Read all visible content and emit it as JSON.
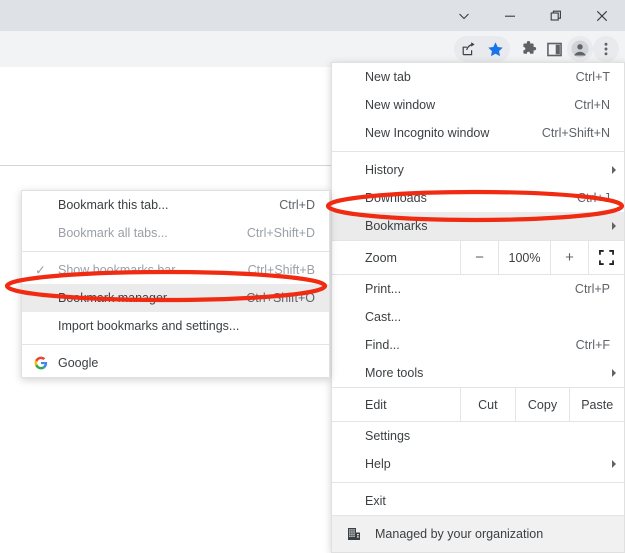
{
  "window_controls": [
    {
      "name": "tab-search-chevron",
      "icon": "chevron-down-icon"
    },
    {
      "name": "minimize",
      "icon": "minimize-icon"
    },
    {
      "name": "maximize",
      "icon": "restore-icon"
    },
    {
      "name": "close",
      "icon": "close-icon"
    }
  ],
  "toolbar": {
    "icons": [
      {
        "name": "share-icon",
        "label": "Share this tab"
      },
      {
        "name": "bookmark-star-icon",
        "label": "Bookmark this tab",
        "color": "#1a73e8"
      },
      {
        "name": "extensions-puzzle-icon",
        "label": "Extensions"
      },
      {
        "name": "side-panel-icon",
        "label": "Side panel"
      },
      {
        "name": "profile-avatar-icon",
        "label": "Profile"
      },
      {
        "name": "three-dot-menu-icon",
        "label": "Customize and control Google Chrome"
      }
    ]
  },
  "main_menu": {
    "items": [
      {
        "label": "New tab",
        "accel": "Ctrl+T",
        "submenu": false,
        "highlight": false
      },
      {
        "label": "New window",
        "accel": "Ctrl+N",
        "submenu": false,
        "highlight": false
      },
      {
        "label": "New Incognito window",
        "accel": "Ctrl+Shift+N",
        "submenu": false,
        "highlight": false
      },
      {
        "label": "History",
        "accel": "",
        "submenu": true,
        "highlight": false
      },
      {
        "label": "Downloads",
        "accel": "Ctrl+J",
        "submenu": false,
        "highlight": false
      },
      {
        "label": "Bookmarks",
        "accel": "",
        "submenu": true,
        "highlight": true
      },
      {
        "label": "Print...",
        "accel": "Ctrl+P",
        "submenu": false,
        "highlight": false
      },
      {
        "label": "Cast...",
        "accel": "",
        "submenu": false,
        "highlight": false
      },
      {
        "label": "Find...",
        "accel": "Ctrl+F",
        "submenu": false,
        "highlight": false
      },
      {
        "label": "More tools",
        "accel": "",
        "submenu": true,
        "highlight": false
      },
      {
        "label": "Settings",
        "accel": "",
        "submenu": false,
        "highlight": false
      },
      {
        "label": "Help",
        "accel": "",
        "submenu": true,
        "highlight": false
      },
      {
        "label": "Exit",
        "accel": "",
        "submenu": false,
        "highlight": false
      }
    ],
    "zoom_row": {
      "label": "Zoom",
      "minus": "−",
      "value": "100%",
      "plus": "+",
      "fullscreen_icon": "fullscreen-icon"
    },
    "edit_row": {
      "label": "Edit",
      "cut": "Cut",
      "copy": "Copy",
      "paste": "Paste"
    },
    "managed": {
      "label": "Managed by your organization",
      "icon": "organization-building-icon"
    }
  },
  "bookmarks_submenu": {
    "items": [
      {
        "label": "Bookmark this tab...",
        "accel": "Ctrl+D",
        "disabled": false,
        "highlight": false,
        "check": false
      },
      {
        "label": "Bookmark all tabs...",
        "accel": "Ctrl+Shift+D",
        "disabled": true,
        "highlight": false,
        "check": false
      },
      {
        "label": "Show bookmarks bar",
        "accel": "Ctrl+Shift+B",
        "disabled": true,
        "highlight": false,
        "check": true
      },
      {
        "label": "Bookmark manager",
        "accel": "Ctrl+Shift+O",
        "disabled": false,
        "highlight": true,
        "check": false
      },
      {
        "label": "Import bookmarks and settings...",
        "accel": "",
        "disabled": false,
        "highlight": false,
        "check": false
      }
    ],
    "bookmark_entry": {
      "label": "Google",
      "icon": "google-favicon"
    }
  },
  "annotations": {
    "color": "#f02b12",
    "items": [
      {
        "name": "bookmarks-highlight-ellipse",
        "target": "Bookmarks"
      },
      {
        "name": "bookmark-manager-highlight-ellipse",
        "target": "Bookmark manager"
      }
    ]
  }
}
